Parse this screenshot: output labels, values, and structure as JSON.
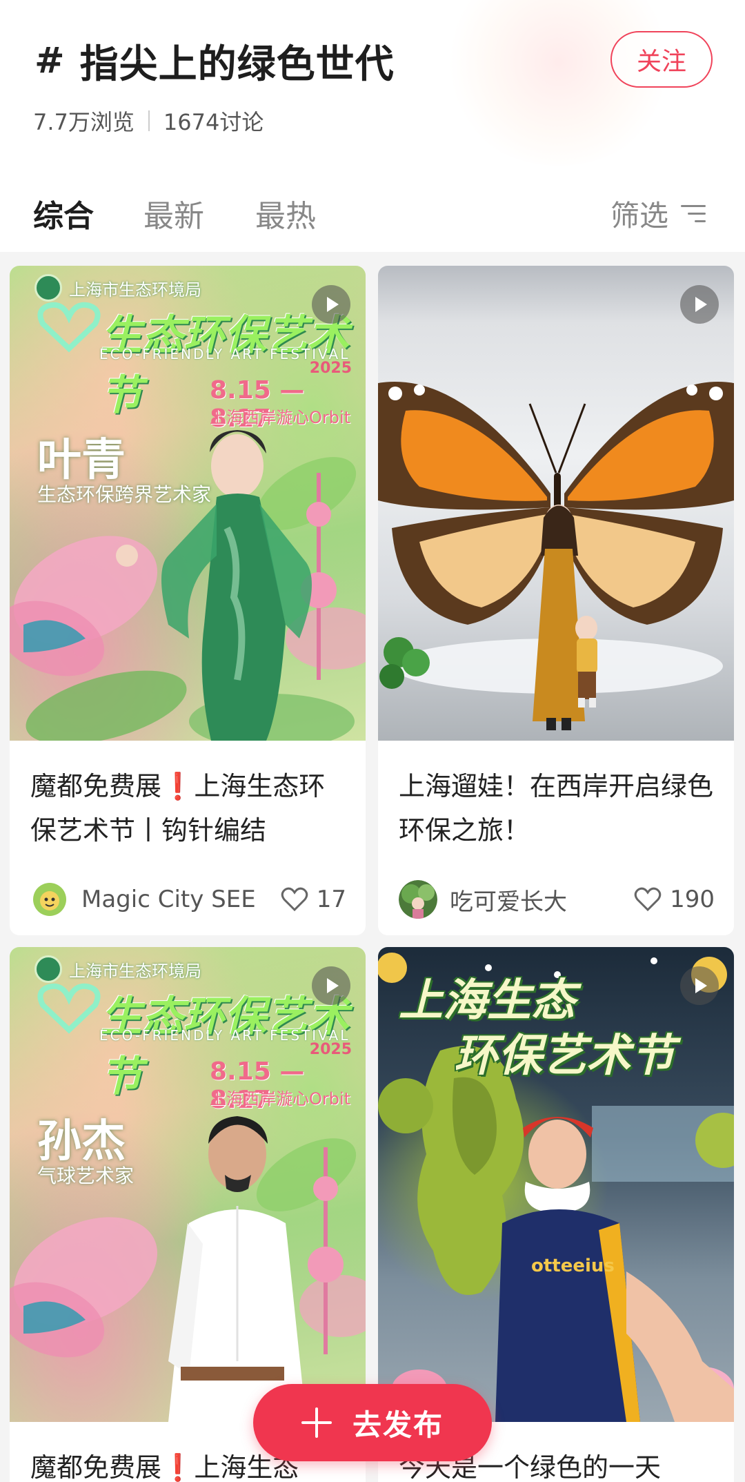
{
  "topic": {
    "title": "指尖上的绿色世代",
    "follow_label": "关注",
    "views": "7.7万浏览",
    "discussions": "1674讨论"
  },
  "tabs": [
    "综合",
    "最新",
    "最热"
  ],
  "active_tab": "综合",
  "filter_label": "筛选",
  "cards": [
    {
      "title_a": "魔都免费展",
      "title_b": "上海生态环保艺术节丨钩针编结",
      "author": "Magic City SEE",
      "likes": "17",
      "video": true,
      "poster": {
        "org": "上海市生态环境局",
        "festival": "生态环保艺术节",
        "festival_en": "ECO-FRIENDLY ART FESTIVAL",
        "year": "2025",
        "dates": "8.15 — 8.17",
        "place": "上海西岸漩心Orbit",
        "person": "叶青",
        "role": "生态环保跨界艺术家"
      }
    },
    {
      "title": "上海遛娃！在西岸开启绿色环保之旅！",
      "author": "吃可爱长大",
      "likes": "190",
      "video": true
    },
    {
      "title_a": "魔都免费展",
      "title_b": "上海生态",
      "video": true,
      "poster": {
        "org": "上海市生态环境局",
        "festival": "生态环保艺术节",
        "festival_en": "ECO-FRIENDLY ART FESTIVAL",
        "year": "2025",
        "dates": "8.15 — 8.17",
        "place": "上海西岸漩心Orbit",
        "person": "孙杰",
        "role": "气球艺术家"
      }
    },
    {
      "title": "今天是一个绿色的一天",
      "video": true,
      "overlay_line1": "上海生态",
      "overlay_line2": "环保艺术节",
      "shirt_text": "otteeius"
    }
  ],
  "publish_label": "去发布",
  "colors": {
    "accent": "#f0364f",
    "follow": "#f0435a"
  }
}
